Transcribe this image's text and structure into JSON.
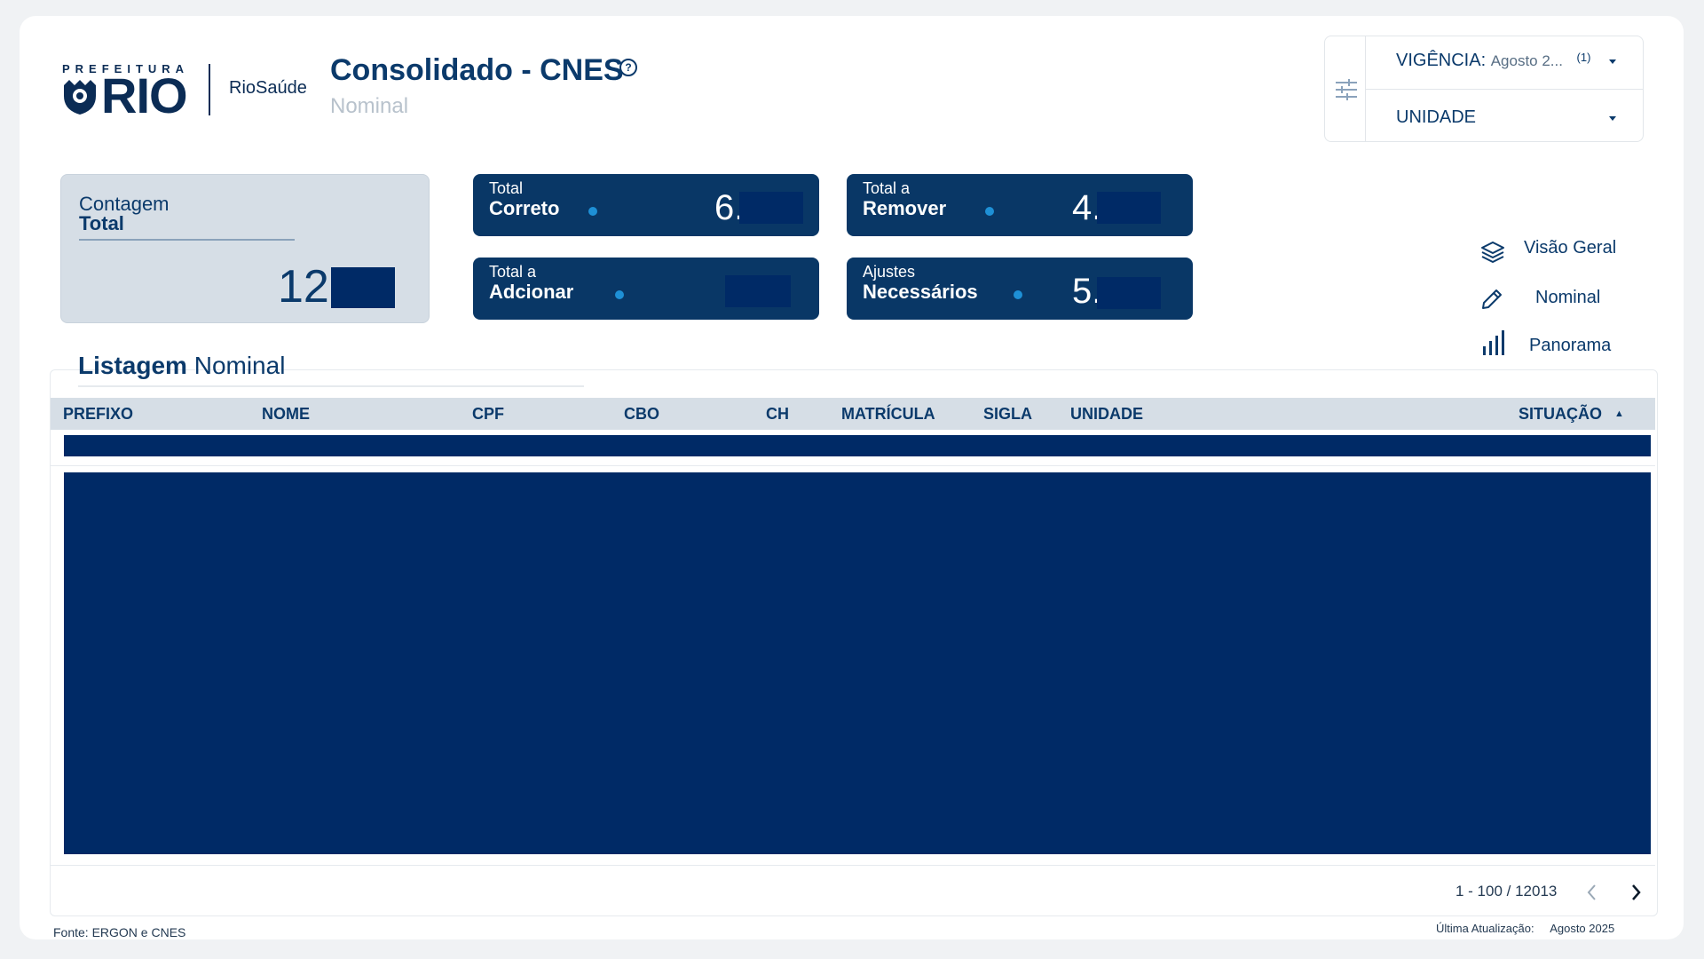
{
  "brand": {
    "prefeitura": "PREFEITURA",
    "rio": "RIO",
    "riosaude": "RioSaúde"
  },
  "header": {
    "title": "Consolidado - CNES",
    "subtitle": "Nominal",
    "help": "?"
  },
  "filters": {
    "vigencia_label": "VIGÊNCIA:",
    "vigencia_value": "Agosto 2...",
    "vigencia_count": "(1)",
    "unidade_label": "UNIDADE"
  },
  "kpis": {
    "total": {
      "line1": "Contagem",
      "line2": "Total",
      "value": "12."
    },
    "correto": {
      "line1": "Total",
      "line2": "Correto",
      "value": "6."
    },
    "remover": {
      "line1": "Total a",
      "line2": "Remover",
      "value": "4."
    },
    "adcionar": {
      "line1": "Total a",
      "line2": "Adcionar",
      "value": ""
    },
    "ajustes": {
      "line1": "Ajustes",
      "line2": "Necessários",
      "value": "5."
    }
  },
  "nav": {
    "visao_geral": "Visão Geral",
    "nominal": "Nominal",
    "panorama": "Panorama"
  },
  "listing": {
    "title_bold": "Listagem",
    "title_rest": "Nominal",
    "columns": [
      "PREFIXO",
      "NOME",
      "CPF",
      "CBO",
      "CH",
      "MATRÍCULA",
      "SIGLA",
      "UNIDADE",
      "SITUAÇÃO"
    ],
    "sort_indicator": "▲",
    "pagination": "1 - 100 / 12013"
  },
  "footer": {
    "source": "Fonte: ERGON e CNES",
    "updated_label": "Última Atualização:",
    "updated_value": "Agosto 2025"
  },
  "colors": {
    "primary": "#093766",
    "redaction": "#002a66",
    "accent_dot": "#1e90d6",
    "kpi_total_bg": "#d6dee6"
  }
}
